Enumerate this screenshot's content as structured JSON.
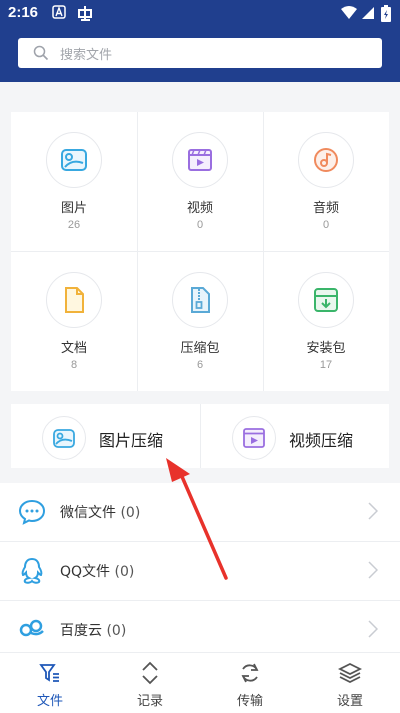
{
  "status": {
    "time": "2:16"
  },
  "search": {
    "placeholder": "搜索文件"
  },
  "categories": [
    {
      "label": "图片",
      "count": "26"
    },
    {
      "label": "视频",
      "count": "0"
    },
    {
      "label": "音频",
      "count": "0"
    },
    {
      "label": "文档",
      "count": "8"
    },
    {
      "label": "压缩包",
      "count": "6"
    },
    {
      "label": "安装包",
      "count": "17"
    }
  ],
  "compress": {
    "image": "图片压缩",
    "video": "视频压缩"
  },
  "list": [
    {
      "name": "微信文件",
      "count": "(0)"
    },
    {
      "name": "QQ文件",
      "count": "(0)"
    },
    {
      "name": "百度云",
      "count": "(0)"
    }
  ],
  "tabs": [
    {
      "label": "文件"
    },
    {
      "label": "记录"
    },
    {
      "label": "传输"
    },
    {
      "label": "设置"
    }
  ],
  "colors": {
    "header": "#203f8e",
    "accent": "#1e57b8",
    "annotation_arrow": "#e8322b"
  }
}
